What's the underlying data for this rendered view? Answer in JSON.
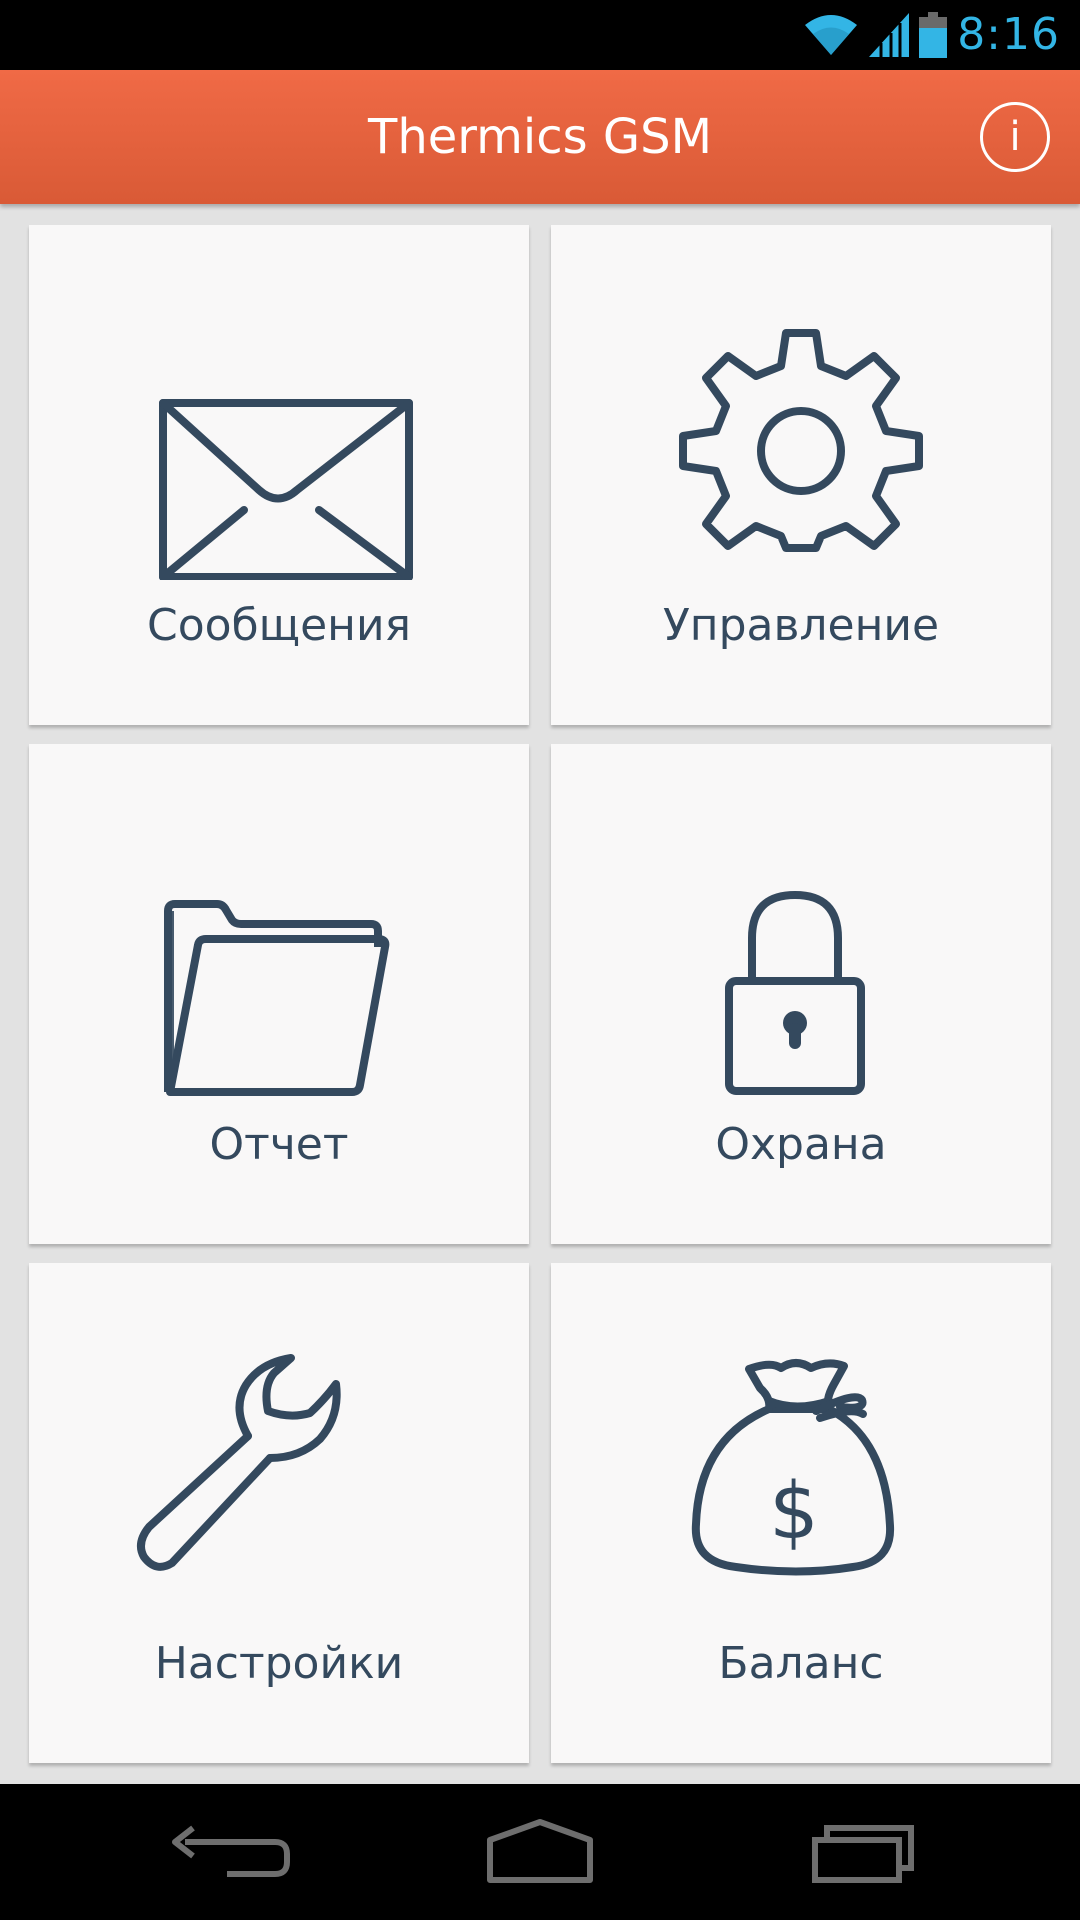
{
  "status_bar": {
    "time": "8:16",
    "icons": [
      "wifi-icon",
      "signal-icon",
      "battery-icon"
    ],
    "clock_color": "#33b5e5"
  },
  "app_bar": {
    "title": "Thermics GSM",
    "info_icon_glyph": "i",
    "gradient_top": "#f06a46",
    "gradient_bottom": "#d95a36"
  },
  "tiles": [
    {
      "label": "Сообщения",
      "icon": "envelope-icon"
    },
    {
      "label": "Управление",
      "icon": "gear-icon"
    },
    {
      "label": "Отчет",
      "icon": "folder-icon"
    },
    {
      "label": "Охрана",
      "icon": "lock-icon"
    },
    {
      "label": "Настройки",
      "icon": "wrench-icon"
    },
    {
      "label": "Баланс",
      "icon": "money-bag-icon"
    }
  ],
  "nav_bar": {
    "buttons": [
      "back-icon",
      "home-icon",
      "recents-icon"
    ]
  },
  "colors": {
    "background": "#e2e2e2",
    "tile_background": "#f9f8f8",
    "icon_and_label": "#34495e"
  }
}
